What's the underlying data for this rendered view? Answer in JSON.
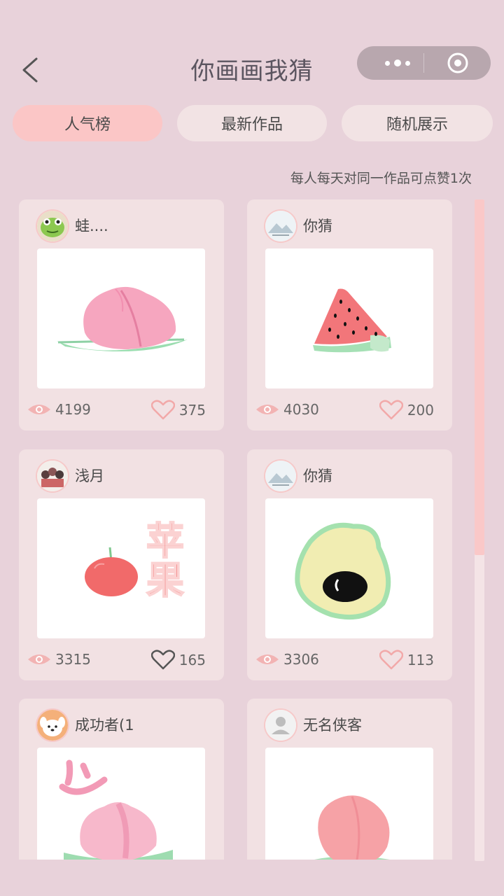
{
  "header": {
    "title": "你画画我猜"
  },
  "tabs": [
    {
      "label": "人气榜",
      "active": true
    },
    {
      "label": "最新作品",
      "active": false
    },
    {
      "label": "随机展示",
      "active": false
    }
  ],
  "tip": "每人每天对同一作品可点赞1次",
  "colors": {
    "background": "#E8D2DA",
    "card": "#F2E1E3",
    "accent": "#FBC6C6",
    "icon": "#F0A8A8"
  },
  "works": [
    {
      "author": "蛙....",
      "views": "4199",
      "likes": "375",
      "avatar_icon": "frog-avatar-icon",
      "art": "peach"
    },
    {
      "author": "你猜",
      "views": "4030",
      "likes": "200",
      "avatar_icon": "mountain-avatar-icon",
      "art": "watermelon"
    },
    {
      "author": "浅月",
      "views": "3315",
      "likes": "165",
      "avatar_icon": "group-avatar-icon",
      "art": "apple"
    },
    {
      "author": "你猜",
      "views": "3306",
      "likes": "113",
      "avatar_icon": "mountain-avatar-icon",
      "art": "avocado"
    },
    {
      "author": "成功者(1",
      "views": "",
      "likes": "",
      "avatar_icon": "dog-avatar-icon",
      "art": "peach"
    },
    {
      "author": "无名侠客",
      "views": "",
      "likes": "",
      "avatar_icon": "default-user-icon",
      "art": "peach"
    }
  ],
  "art_text": {
    "apple_word": "苹果"
  }
}
